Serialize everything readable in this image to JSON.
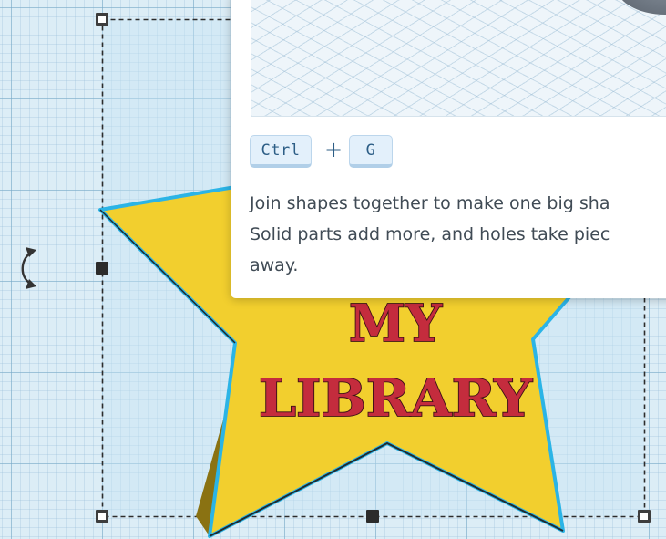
{
  "workplane": {
    "colors": {
      "grid_background": "#dcedf6",
      "selection_fill": "#c8e4f5"
    },
    "rotate_handle_icon": "rotate-arrow-icon",
    "selected_shape": {
      "name": "star",
      "colors": {
        "fill": "#f2cf2e",
        "side": "#8a7212",
        "outline": "#2bb4e6",
        "text": "#c42c3d"
      },
      "text_lines": [
        "MY",
        "LIBRARY"
      ]
    }
  },
  "tooltip": {
    "shortcut": {
      "key1": "Ctrl",
      "plus": "+",
      "key2": "G"
    },
    "description_lines": [
      "Join shapes together to make one big sha",
      "Solid parts add more, and holes take piec",
      "away."
    ]
  }
}
